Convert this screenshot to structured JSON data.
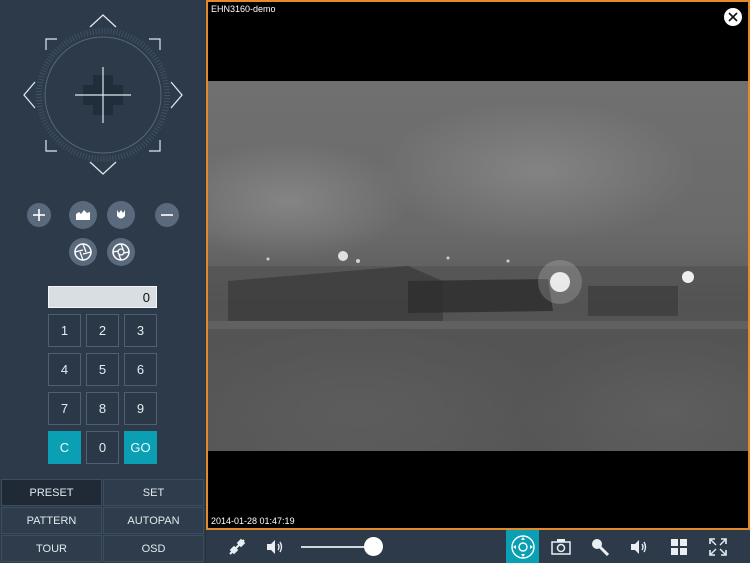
{
  "video": {
    "camera_name": "EHN3160-demo",
    "timestamp": "2014-01-28 01:47:19"
  },
  "keypad": {
    "display_value": "0",
    "keys": [
      "1",
      "2",
      "3",
      "4",
      "5",
      "6",
      "7",
      "8",
      "9",
      "C",
      "0",
      "GO"
    ]
  },
  "modes": {
    "preset": "PRESET",
    "set": "SET",
    "pattern": "PATTERN",
    "autopan": "AUTOPAN",
    "tour": "TOUR",
    "osd": "OSD"
  },
  "volume": {
    "level": 1.0
  },
  "colors": {
    "accent": "#0a9fb3",
    "frame_border": "#e38a2b",
    "panel": "#2c3a4a"
  }
}
